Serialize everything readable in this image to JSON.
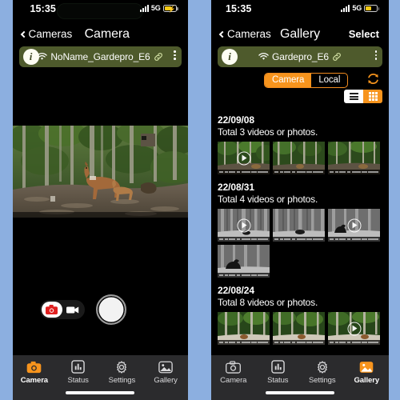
{
  "theme": {
    "background": "#8cafe0",
    "accent_orange": "#f7941d",
    "device_bar_olive": "#4e5a2c",
    "tabbar": "#2b2b2d",
    "record_red": "#e02020"
  },
  "left_phone": {
    "status": {
      "time": "15:35",
      "network": "5G",
      "signal_icon": "signal-bars-icon",
      "battery_icon": "battery-charging-icon",
      "battery_level_pct": 55,
      "charging": true
    },
    "nav": {
      "back_label": "Cameras",
      "title": "Camera",
      "back_icon": "chevron-left-icon"
    },
    "device_bar": {
      "info_icon": "info-icon",
      "info_glyph": "i",
      "wifi_icon": "wifi-icon",
      "name": "NoName_Gardepro_E6",
      "link_icon": "link-icon",
      "menu_icon": "more-vertical-icon"
    },
    "preview": {
      "alt": "trail-camera-live-preview-deer-in-forest"
    },
    "controls": {
      "photo_mode_icon": "photo-camera-icon",
      "video_mode_icon": "video-camera-icon",
      "selected_mode": "photo",
      "shutter_label": "shutter-button"
    },
    "tabs": [
      {
        "label": "Camera",
        "icon": "photo-camera-icon",
        "active": true
      },
      {
        "label": "Status",
        "icon": "bar-chart-icon",
        "active": false
      },
      {
        "label": "Settings",
        "icon": "gear-icon",
        "active": false
      },
      {
        "label": "Gallery",
        "icon": "photo-library-icon",
        "active": false
      }
    ]
  },
  "right_phone": {
    "status": {
      "time": "15:35",
      "network": "5G",
      "signal_icon": "signal-bars-icon",
      "battery_icon": "battery-low-power-icon",
      "battery_level_pct": 48,
      "charging": false
    },
    "nav": {
      "back_label": "Cameras",
      "title": "Gallery",
      "action_label": "Select",
      "back_icon": "chevron-left-icon"
    },
    "device_bar": {
      "info_icon": "info-icon",
      "info_glyph": "i",
      "wifi_icon": "wifi-icon",
      "name": "Gardepro_E6",
      "link_icon": "link-icon",
      "menu_icon": "more-vertical-icon"
    },
    "source_segments": [
      {
        "label": "Camera",
        "active": true
      },
      {
        "label": "Local",
        "active": false
      }
    ],
    "refresh_icon": "refresh-icon",
    "view_modes": [
      {
        "name": "list-view",
        "icon": "list-icon",
        "active": false
      },
      {
        "name": "grid-view",
        "icon": "grid-icon",
        "active": true
      }
    ],
    "groups": [
      {
        "date": "22/09/08",
        "total_text": "Total  3 videos or photos.",
        "count": 3,
        "scene": "forest",
        "items": [
          {
            "type": "video",
            "alt": "forest-daylight-thumbnail-1"
          },
          {
            "type": "photo",
            "alt": "forest-daylight-thumbnail-2"
          },
          {
            "type": "photo",
            "alt": "forest-daylight-thumbnail-3"
          }
        ]
      },
      {
        "date": "22/08/31",
        "total_text": "Total  4 videos or photos.",
        "count": 4,
        "scene": "night",
        "items": [
          {
            "type": "video",
            "alt": "night-vision-bear-thumbnail-1"
          },
          {
            "type": "photo",
            "alt": "night-vision-bear-thumbnail-2"
          },
          {
            "type": "video",
            "alt": "night-vision-bear-thumbnail-3"
          },
          {
            "type": "photo",
            "alt": "night-vision-bear-thumbnail-4"
          }
        ]
      },
      {
        "date": "22/08/24",
        "total_text": "Total  8 videos or photos.",
        "count": 8,
        "scene": "forest",
        "items": [
          {
            "type": "photo",
            "alt": "forest-fox-thumbnail-1"
          },
          {
            "type": "photo",
            "alt": "forest-fox-thumbnail-2"
          },
          {
            "type": "video",
            "alt": "forest-fox-thumbnail-3"
          }
        ]
      }
    ],
    "tabs": [
      {
        "label": "Camera",
        "icon": "photo-camera-icon",
        "active": false
      },
      {
        "label": "Status",
        "icon": "bar-chart-icon",
        "active": false
      },
      {
        "label": "Settings",
        "icon": "gear-icon",
        "active": false
      },
      {
        "label": "Gallery",
        "icon": "photo-library-icon",
        "active": true
      }
    ]
  }
}
